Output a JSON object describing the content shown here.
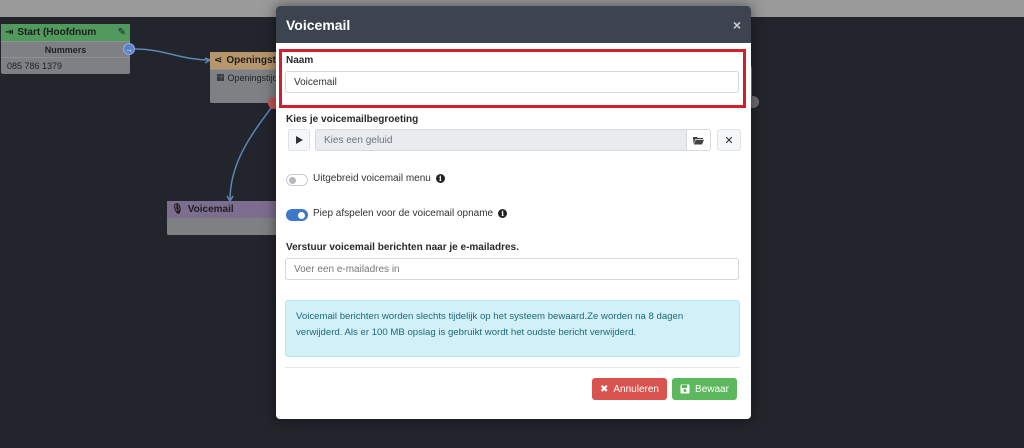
{
  "flow": {
    "start_node": {
      "title": "Start (Hoofdnum",
      "row_header": "Nummers",
      "number": "085 786 1379"
    },
    "opening_node": {
      "title": "Openingsti",
      "row_label": "Openingstijden"
    },
    "voicemail_node": {
      "title": "Voicemail"
    }
  },
  "modal": {
    "title": "Voicemail",
    "close_label": "×",
    "name_label": "Naam",
    "name_value": "Voicemail",
    "greeting_label": "Kies je voicemailbegroeting",
    "greeting_placeholder": "Kies een geluid",
    "extended_menu_label": "Uitgebreid voicemail menu",
    "beep_label": "Piep afspelen voor de voicemail opname",
    "email_label": "Verstuur voicemail berichten naar je e-mailadres.",
    "email_placeholder": "Voer een e-mailadres in",
    "info_text": "Voicemail berichten worden slechts tijdelijk op het systeem bewaard.Ze worden na 8 dagen verwijderd. Als er 100 MB opslag is gebruikt wordt het oudste bericht verwijderd.",
    "cancel_label": "Annuleren",
    "save_label": "Bewaar",
    "extended_menu_enabled": false,
    "beep_enabled": true
  },
  "colors": {
    "highlight": "#d0202e",
    "modal_header": "#3b444f",
    "cancel": "#d9534f",
    "save": "#5cb85c",
    "toggle_on": "#3e78c9"
  }
}
